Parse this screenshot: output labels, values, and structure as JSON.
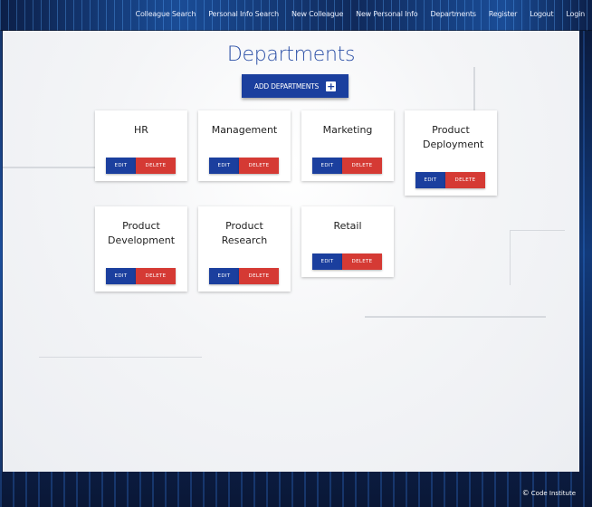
{
  "nav": {
    "links": [
      "Colleague Search",
      "Personal Info Search",
      "New Colleague",
      "New Personal Info",
      "Departments",
      "Register",
      "Logout",
      "Login"
    ]
  },
  "main": {
    "title": "Departments",
    "add_button_label": "ADD DEPARTMENTS",
    "add_button_icon": "plus-icon"
  },
  "departments": [
    {
      "name": "HR"
    },
    {
      "name": "Management"
    },
    {
      "name": "Marketing"
    },
    {
      "name": "Product Deployment"
    },
    {
      "name": "Product Development"
    },
    {
      "name": "Product Research"
    },
    {
      "name": "Retail"
    }
  ],
  "card_buttons": {
    "edit": "EDIT",
    "delete": "DELETE"
  },
  "footer": {
    "text": "Code Institute",
    "icon": "copyright-icon"
  },
  "colors": {
    "primary": "#1b3f9e",
    "danger": "#d53a34",
    "title": "#2b4fa6"
  }
}
